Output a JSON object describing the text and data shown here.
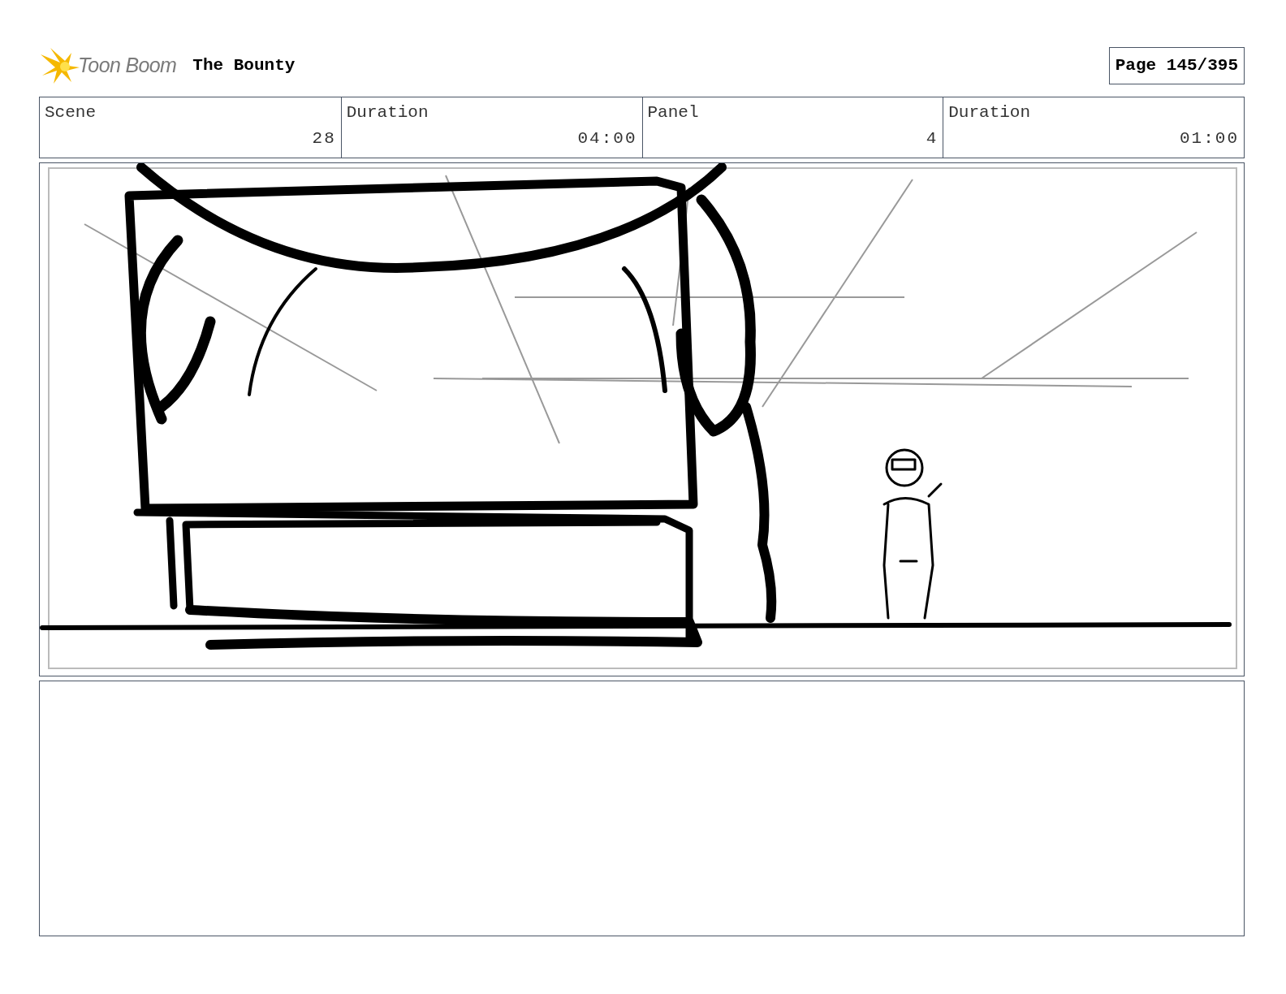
{
  "header": {
    "logo": "Toon Boom",
    "title": "The Bounty",
    "page": "Page 145/395"
  },
  "info": {
    "columns": [
      "Scene",
      "Duration",
      "Panel",
      "Duration"
    ],
    "values": [
      "28",
      "04:00",
      "4",
      "01:00"
    ]
  },
  "panel": {
    "kind": "sketch"
  }
}
